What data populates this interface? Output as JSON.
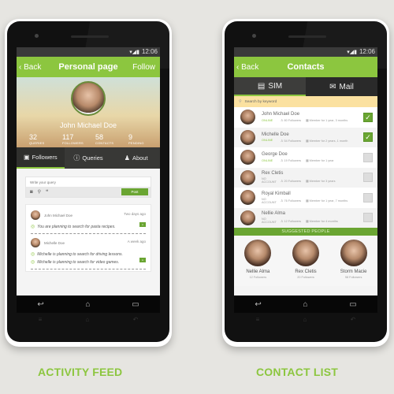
{
  "status_bar": {
    "time": "12:06"
  },
  "activity_feed": {
    "caption": "ACTIVITY FEED",
    "appbar": {
      "back_label": "Back",
      "title": "Personal page",
      "action_label": "Follow"
    },
    "profile": {
      "name": "John Michael Doe",
      "stats": [
        {
          "value": "32",
          "label": "QUERIES"
        },
        {
          "value": "117",
          "label": "FOLLOWERS"
        },
        {
          "value": "58",
          "label": "CONTACTS"
        },
        {
          "value": "9",
          "label": "PENDING"
        }
      ]
    },
    "tabs": [
      {
        "label": "Followers",
        "icon": "followers-icon",
        "active": true
      },
      {
        "label": "Queries",
        "icon": "question-icon",
        "active": false
      },
      {
        "label": "About",
        "icon": "person-icon",
        "active": false
      }
    ],
    "compose": {
      "placeholder": "Write your query",
      "post_label": "Post"
    },
    "feed": [
      {
        "name": "John Michael Doe",
        "time": "Two days ago",
        "lines": [
          "You are planning to search for pasta recipes."
        ]
      },
      {
        "name": "Michelle Doe",
        "time": "A week ago",
        "lines": [
          "Michelle is planning to search for driving lessons.",
          "Michelle is planning to search for video games."
        ]
      }
    ]
  },
  "contact_list": {
    "caption": "CONTACT LIST",
    "appbar": {
      "back_label": "Back",
      "title": "Contacts"
    },
    "tabs": [
      {
        "label": "SIM",
        "active": true
      },
      {
        "label": "Mail",
        "active": false
      }
    ],
    "search_placeholder": "Search by keyword",
    "contacts": [
      {
        "name": "John Michael Doe",
        "status": "ONLINE",
        "followers": "80 Followers",
        "member": "Member for 1 year, 3 months",
        "checked": true
      },
      {
        "name": "Michelle Doe",
        "status": "ONLINE",
        "followers": "54 Followers",
        "member": "Member for 2 years, 1 month",
        "checked": true
      },
      {
        "name": "George Doe",
        "status": "ONLINE",
        "followers": "19 Followers",
        "member": "Member for 1 year",
        "checked": false
      },
      {
        "name": "Rex Cletis",
        "status": "NO ACCOUNT",
        "followers": "20 Followers",
        "member": "Member for 3 years",
        "checked": false
      },
      {
        "name": "Royal Kimball",
        "status": "NO ACCOUNT",
        "followers": "76 Followers",
        "member": "Member for 1 year, 7 months",
        "checked": false
      },
      {
        "name": "Nellie Alma",
        "status": "NO ACCOUNT",
        "followers": "12 Followers",
        "member": "Member for 4 months",
        "checked": false
      }
    ],
    "suggested_header": "SUGGESTED PEOPLE",
    "suggested": [
      {
        "name": "Nellie Alma",
        "followers": "12 Followers"
      },
      {
        "name": "Rex Cletis",
        "followers": "20 Followers"
      },
      {
        "name": "Storm Macie",
        "followers": "98 Followers"
      }
    ]
  },
  "nav": {
    "back": "↩",
    "home": "⌂",
    "recent": "▭"
  },
  "colors": {
    "accent": "#8cc63f",
    "accent_dark": "#6aa532",
    "search_bg": "#fbe1a0"
  }
}
